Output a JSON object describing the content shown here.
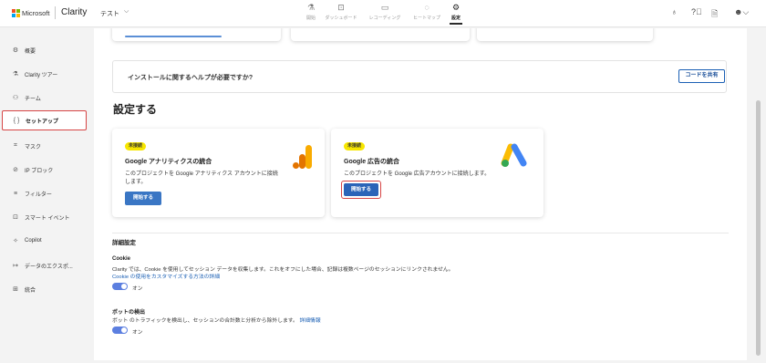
{
  "header": {
    "brand_microsoft": "Microsoft",
    "brand_clarity": "Clarity",
    "project_name": "テスト",
    "nav": [
      {
        "label": "開始",
        "icon": "flask-icon"
      },
      {
        "label": "ダッシュボード",
        "icon": "dashboard-icon"
      },
      {
        "label": "レコーディング",
        "icon": "video-icon"
      },
      {
        "label": "ヒートマップ",
        "icon": "heatmap-icon"
      },
      {
        "label": "設定",
        "icon": "gear-icon",
        "active": true
      }
    ],
    "right_icons": [
      "share-people-icon",
      "help-icon",
      "document-icon",
      "account-icon"
    ]
  },
  "sidebar": {
    "items": [
      {
        "label": "概要",
        "icon": "gear-icon"
      },
      {
        "label": "Clarity ツアー",
        "icon": "flask-icon"
      },
      {
        "label": "チーム",
        "icon": "team-icon"
      },
      {
        "label": "セットアップ",
        "icon": "braces-icon",
        "active": true
      },
      {
        "label": "マスク",
        "icon": "mask-icon"
      },
      {
        "label": "IP ブロック",
        "icon": "globe-block-icon"
      },
      {
        "label": "フィルター",
        "icon": "filter-icon"
      },
      {
        "label": "スマート イベント",
        "icon": "smart-event-icon"
      },
      {
        "label": "Copilot",
        "icon": "copilot-icon"
      },
      {
        "label": "データのエクスポ...",
        "icon": "export-icon"
      },
      {
        "label": "統合",
        "icon": "integration-icon"
      }
    ]
  },
  "main": {
    "help_text": "インストールに関するヘルプが必要ですか?",
    "share_code_button": "コードを共有",
    "section_title": "設定する",
    "cards": [
      {
        "badge": "未接続",
        "title": "Google アナリティクスの統合",
        "description": "このプロジェクトを Google アナリティクス アカウントに接続します。",
        "button": "開始する"
      },
      {
        "badge": "未接続",
        "title": "Google 広告の統合",
        "description": "このプロジェクトを Google 広告アカウントに接続します。",
        "button": "開始する"
      }
    ],
    "advanced_title": "詳細設定",
    "cookie": {
      "title": "Cookie",
      "description": "Clarity では、Cookie を使用してセッション データを収集します。これをオフにした場合、記録は複数ページのセッションにリンクされません。",
      "link": "Cookie の使用をカスタマイズする方法の詳細",
      "toggle_label": "オン"
    },
    "bot": {
      "title": "ボットの検出",
      "description": "ボット のトラフィックを検出し、セッションの合計数と分析から除外します。",
      "link": "詳細情報",
      "toggle_label": "オン"
    }
  },
  "colors": {
    "accent": "#2b64b8",
    "highlight_border": "#d64545",
    "badge": "#f7e600",
    "toggle": "#5c7fe0"
  }
}
